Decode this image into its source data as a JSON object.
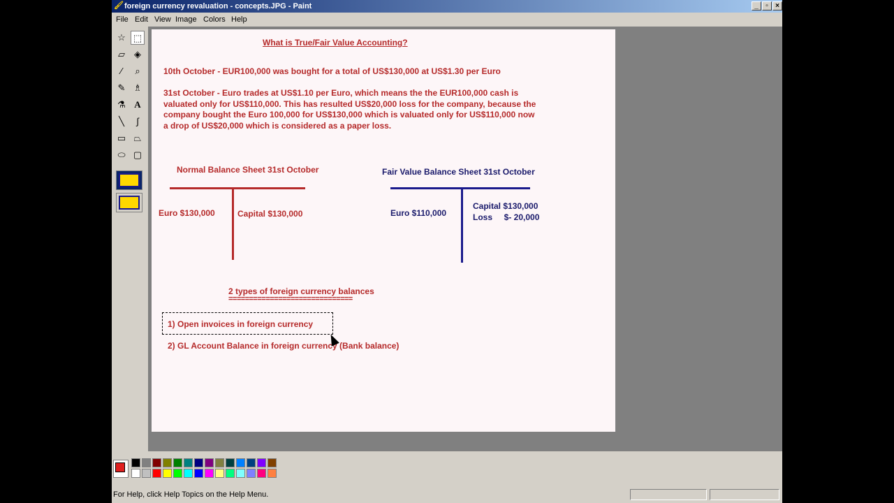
{
  "window": {
    "title": "foreign currency revaluation - concepts.JPG - Paint"
  },
  "menu": {
    "items": [
      "File",
      "Edit",
      "View",
      "Image",
      "Colors",
      "Help"
    ]
  },
  "tools": [
    "free-form-select",
    "select",
    "eraser",
    "fill",
    "pick-color",
    "magnifier",
    "pencil",
    "brush",
    "airbrush",
    "text",
    "line",
    "curve",
    "rectangle",
    "polygon",
    "ellipse",
    "rounded-rectangle"
  ],
  "canvas": {
    "heading": "What is True/Fair Value Accounting?",
    "line1": "10th October - EUR100,000 was bought for a total of US$130,000 at US$1.30 per Euro",
    "para": [
      "31st October - Euro trades at US$1.10 per Euro, which means the the EUR100,000 cash is",
      "valuated only for US$110,000. This has resulted US$20,000 loss for the company, because the",
      "company bought the Euro 100,000 for US$130,000 which is valuated only for US$110,000 now",
      "a drop of US$20,000 which is considered as a paper loss."
    ],
    "normal_sheet": {
      "title": "Normal Balance Sheet  31st October",
      "left": "Euro $130,000",
      "right": "Capital $130,000"
    },
    "fair_sheet": {
      "title": "Fair Value Balance Sheet 31st October",
      "left": "Euro $110,000",
      "right1": "Capital $130,000",
      "right2": "Loss     $- 20,000"
    },
    "types_title": "2 types of foreign currency balances",
    "types_underline": "==============================",
    "type1": "1) Open invoices in foreign currency",
    "type2": "2) GL Account Balance in foreign currency (Bank balance)"
  },
  "colors": {
    "current_fg": "#e02020",
    "current_bg": "#ffffff",
    "palette_row1": [
      "#000000",
      "#808080",
      "#800000",
      "#808000",
      "#008000",
      "#008080",
      "#000080",
      "#800080",
      "#808040",
      "#004040",
      "#0080ff",
      "#004080",
      "#8000ff",
      "#804000"
    ],
    "palette_row2": [
      "#ffffff",
      "#c0c0c0",
      "#ff0000",
      "#ffff00",
      "#00ff00",
      "#00ffff",
      "#0000ff",
      "#ff00ff",
      "#ffff80",
      "#00ff80",
      "#80ffff",
      "#8080ff",
      "#ff0080",
      "#ff8040"
    ],
    "text_red": "#b52a2a",
    "text_blue": "#1a1a6b"
  },
  "status": {
    "text": "For Help, click Help Topics on the Help Menu."
  }
}
